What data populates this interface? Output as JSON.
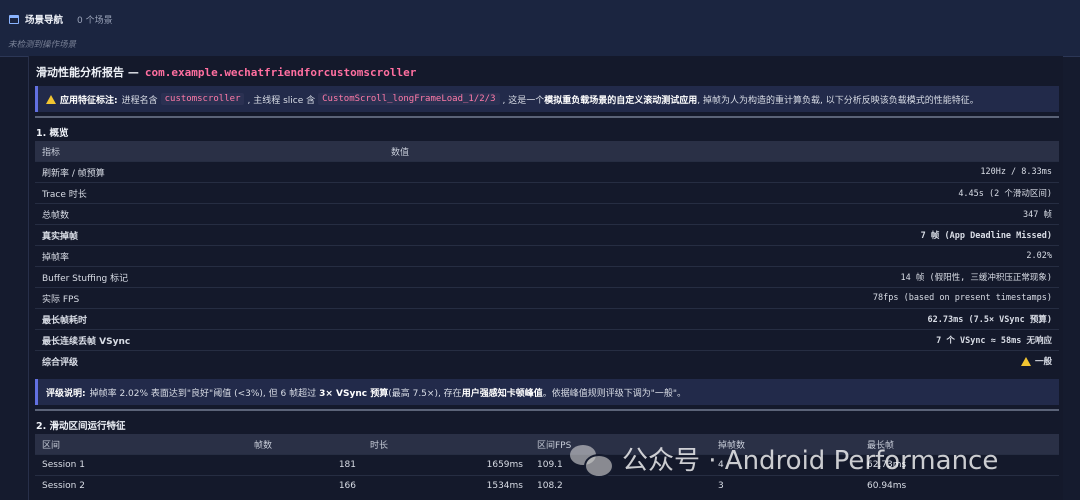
{
  "nav": {
    "title": "场景导航",
    "count": "0 个场景",
    "empty": "未检测到操作场景"
  },
  "report": {
    "title": "滑动性能分析报告 —",
    "package": "com.example.wechatfriendforcustomscroller"
  },
  "feature_note": {
    "label": "应用特征标注:",
    "t1": "进程名含",
    "c1": "customscroller",
    "t2": ", 主线程 slice 含",
    "c2": "CustomScroll_longFrameLoad_1/2/3",
    "t3": ", 这是一个",
    "bold": "模拟重负载场景的自定义滚动测试应用",
    "t4": ", 掉帧为人为构造的重计算负载, 以下分析反映该负载模式的性能特征。"
  },
  "overview": {
    "heading": "1. 概览",
    "col_metric": "指标",
    "col_value": "数值",
    "rows": [
      {
        "k": "刷新率 / 帧预算",
        "v": "120Hz / 8.33ms"
      },
      {
        "k": "Trace 时长",
        "v": "4.45s (2 个滑动区间)"
      },
      {
        "k": "总帧数",
        "v": "347 帧"
      },
      {
        "k": "真实掉帧",
        "v": "7 帧 (App Deadline Missed)"
      },
      {
        "k": "掉帧率",
        "v": "2.02%"
      },
      {
        "k": "Buffer Stuffing 标记",
        "v": "14 帧 (假阳性, 三缓冲积压正常现象)"
      },
      {
        "k": "实际 FPS",
        "v": "78fps (based on present timestamps)"
      },
      {
        "k": "最长帧耗时",
        "v": "62.73ms (7.5× VSync 预算)"
      },
      {
        "k": "最长连续丢帧 VSync",
        "v": "7 个 VSync ≈ 58ms 无响应"
      },
      {
        "k": "综合评级",
        "v": "一般"
      }
    ]
  },
  "rating_note": {
    "label": "评级说明:",
    "t1": "掉帧率 2.02% 表面达到\"良好\"阈值 (<3%), 但 6 帧超过",
    "b1": "3× VSync 预算",
    "t2": " (最高 7.5×), 存在",
    "b2": "用户强感知卡顿峰值",
    "t3": "。依据峰值规则评级下调为\"一般\"。"
  },
  "sessions": {
    "heading": "2. 滑动区间运行特征",
    "cols": [
      "区间",
      "帧数",
      "时长",
      "区间FPS",
      "掉帧数",
      "最长帧"
    ],
    "rows": [
      [
        "Session 1",
        "181",
        "1659ms",
        "109.1",
        "4",
        "62.73ms"
      ],
      [
        "Session 2",
        "166",
        "1534ms",
        "108.2",
        "3",
        "60.94ms"
      ]
    ]
  },
  "watermark": {
    "text": "公众号 · Android Performance"
  },
  "colors": {
    "background": "#151b2e",
    "accent": "#6270e0",
    "code": "#ff7aa8",
    "warning": "#f2c531"
  }
}
